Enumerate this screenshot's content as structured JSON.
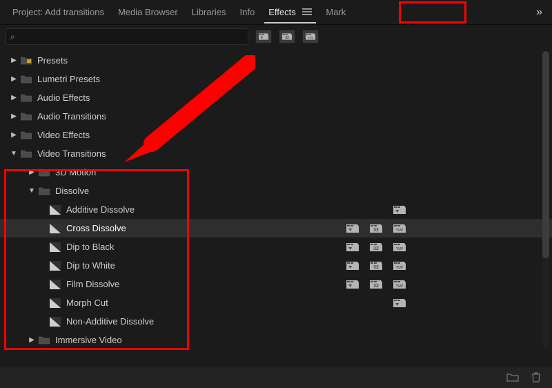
{
  "tabs": {
    "project": "Project: Add transitions",
    "mediaBrowser": "Media Browser",
    "libraries": "Libraries",
    "info": "Info",
    "effects": "Effects",
    "markers": "Mark"
  },
  "search": {
    "value": ""
  },
  "folders": {
    "presets": "Presets",
    "lumetri": "Lumetri Presets",
    "audioEffects": "Audio Effects",
    "audioTransitions": "Audio Transitions",
    "videoEffects": "Video Effects",
    "videoTransitions": "Video Transitions",
    "3dMotion": "3D Motion",
    "dissolve": "Dissolve",
    "immersive": "Immersive Video"
  },
  "effects": {
    "additive": "Additive Dissolve",
    "cross": "Cross Dissolve",
    "dipBlack": "Dip to Black",
    "dipWhite": "Dip to White",
    "film": "Film Dissolve",
    "morph": "Morph Cut",
    "nonAdditive": "Non-Additive Dissolve"
  }
}
